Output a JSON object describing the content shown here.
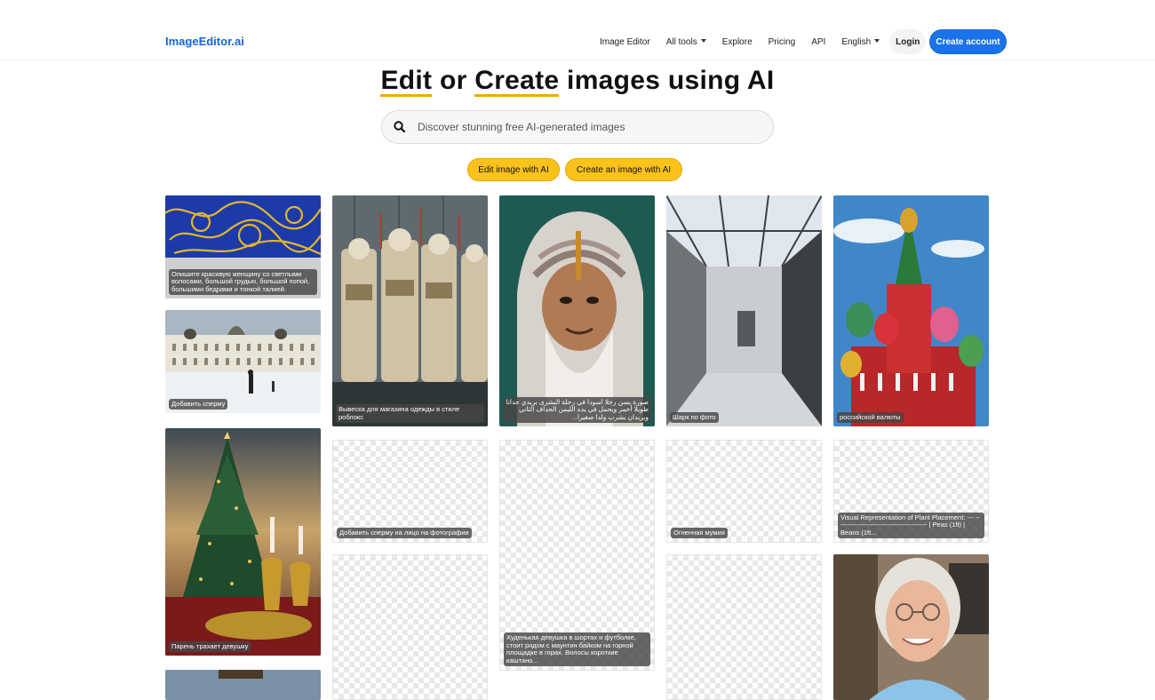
{
  "nav": {
    "brand": "ImageEditor.ai",
    "items": [
      "Image Editor",
      "All tools",
      "Explore",
      "Pricing",
      "API",
      "English"
    ],
    "login": "Login",
    "create_account": "Create account"
  },
  "hero": {
    "title_part1": "Edit",
    "title_part2": " or ",
    "title_part3": "Create",
    "title_part4": " images using AI"
  },
  "search": {
    "placeholder": "Discover stunning free AI-generated images"
  },
  "buttons": {
    "edit": "Edit image with AI",
    "create": "Create an image with AI"
  },
  "gallery": {
    "c1_1": "Опишите красивую женщину со светлыми волосами, большой грудью, большой попой, большими бедрами и тонкой талией.",
    "c1_2": "Добавить сперму",
    "c1_3": "Парень трахает девушку",
    "c2_1": "Вывеска для магазина одежды в стиле роблокс",
    "c2_2": "Добавить сперму на лицо на фотографии",
    "c3_1": "صورة بسن رجلا اسودا في رحلة البشرى بريدي جداتا طويلا أحمر ويحمل في يده الليمن الجداف الثاني ويريدان يشرب ولدا صغيرا...",
    "c3_2": "Худенькая девушка в шортах и футболке, стоит рядом с маунтин байком на горной площадке в горах. Волосы короткие каштано...",
    "c4_1": "Шарк по фото",
    "c4_2": "Огненная мумия",
    "c5_1": "российской валюты",
    "c5_2": "Visual Representation of Plant Placement: --- ----------------------------------------- | Peas (1ft) | Beans (1ft..."
  }
}
